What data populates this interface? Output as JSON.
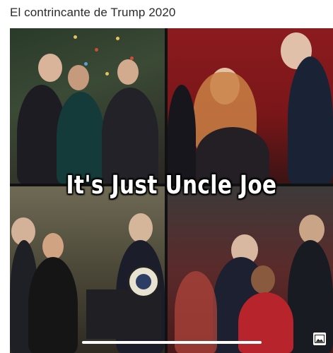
{
  "post": {
    "title": "El contrincante de Trump 2020"
  },
  "media": {
    "caption": "It's Just Uncle Joe",
    "image_icon": "image-gallery-icon"
  },
  "colors": {
    "caption_text": "#ffffff",
    "title_text": "#2b2b2b",
    "background": "#ffffff"
  }
}
